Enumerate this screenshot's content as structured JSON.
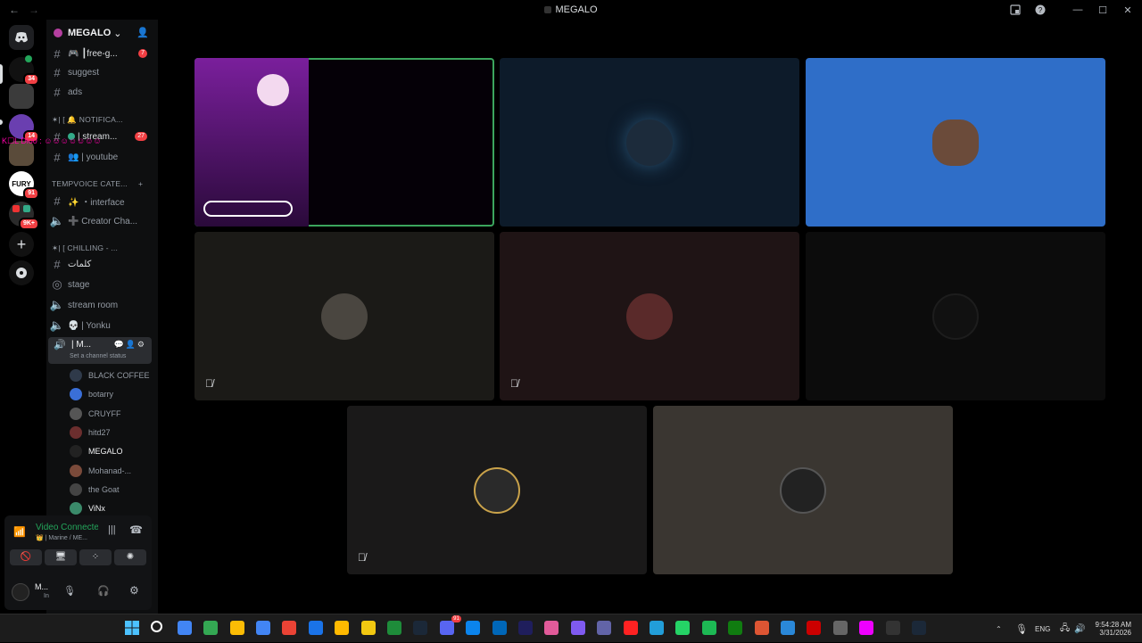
{
  "window": {
    "title": "MEGALO",
    "back": "←",
    "forward": "→"
  },
  "guilds": {
    "badges": {
      "g1": "34",
      "g3": "14",
      "g5": "91",
      "g6": "9K+"
    },
    "fury_text": "FURY"
  },
  "server": {
    "name": "MEGALO",
    "chevron": "⌄"
  },
  "channels": {
    "free_games": "🎮 ┃free-g...",
    "free_games_badge": "7",
    "suggest": "suggest",
    "ads": "ads",
    "cat_notifications": "✶| [ 🔔 NOTIFICA...",
    "stream": "| stream...",
    "stream_badge": "27",
    "youtube": "👥 | youtube",
    "cat_tempvoice": "TEMPVOICE CATE...",
    "interface": "✨ ・interface",
    "creator": "➕ Creator Cha...",
    "cat_chilling": "✶| [ CHILLING - ...",
    "arabic": "كلمات",
    "stage": "stage",
    "stream_room": "stream room",
    "yonku": "💀 | Yonku",
    "active_voice": "| M...",
    "channel_status": "Set a channel status",
    "overlay_text": "K☐L Dlo0 : ☺☺☺☺☺☺☺"
  },
  "voice_users": [
    {
      "name": "BLACK COFFEE",
      "color": "#2f3a4a"
    },
    {
      "name": "botarry",
      "color": "#3a6fd8"
    },
    {
      "name": "CRUYFF",
      "color": "#555555"
    },
    {
      "name": "hitd27",
      "color": "#6b2e2e"
    },
    {
      "name": "MEGALO",
      "color": "#222222"
    },
    {
      "name": "Mohanad-...",
      "color": "#7a4a3a"
    },
    {
      "name": "the Goat",
      "color": "#444444"
    },
    {
      "name": "ViNx",
      "color": "#3a8a6a"
    }
  ],
  "panel": {
    "status": "Video Connecte",
    "channel": "👑 | Marine / ME...",
    "user_name": "M...",
    "user_sub": "In"
  },
  "tiles": [
    {
      "name": "tile-1",
      "bg": "#050007",
      "speaking": true,
      "muted": false
    },
    {
      "name": "tile-2",
      "bg": "#0d1b2a",
      "muted": false
    },
    {
      "name": "tile-3",
      "bg": "#2f6ec8",
      "muted": false
    },
    {
      "name": "tile-4",
      "bg": "#1b1a17",
      "muted": true
    },
    {
      "name": "tile-5",
      "bg": "#1f1415",
      "muted": true
    },
    {
      "name": "tile-6",
      "bg": "#0c0c0c",
      "muted": false
    },
    {
      "name": "tile-7",
      "bg": "#1a1919",
      "muted": true
    },
    {
      "name": "tile-8",
      "bg": "#3a3631",
      "muted": false
    }
  ],
  "taskbar": {
    "lang": "ENG",
    "time": "9:54:28 AM",
    "date": "3/31/2026",
    "discord_badge": "91"
  },
  "colors": {
    "accent_green": "#23a55a",
    "speaking_border": "#3ba55d",
    "badge_red": "#f23f43"
  }
}
